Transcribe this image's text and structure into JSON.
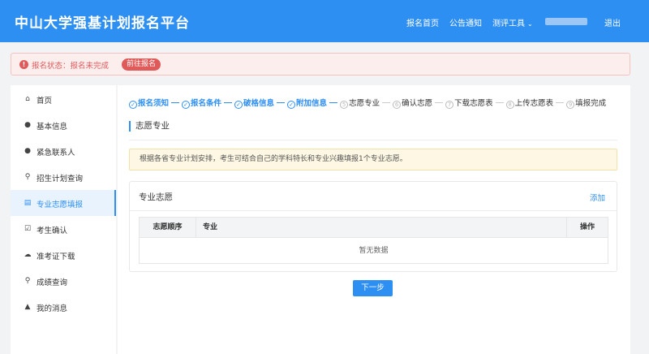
{
  "header": {
    "brand": "中山大学强基计划报名平台",
    "nav": {
      "home": "报名首页",
      "notice": "公告通知",
      "tools": "测评工具",
      "logout": "退出"
    }
  },
  "status": {
    "icon": "!",
    "text": "报名状态：报名未完成",
    "button": "前往报名"
  },
  "sidebar": {
    "items": [
      {
        "label": "首页",
        "icon": "home-icon",
        "glyph": "⌂"
      },
      {
        "label": "基本信息",
        "icon": "user-icon",
        "glyph": "●"
      },
      {
        "label": "紧急联系人",
        "icon": "contact-user-icon",
        "glyph": "●"
      },
      {
        "label": "招生计划查询",
        "icon": "search-icon",
        "glyph": "⚲"
      },
      {
        "label": "专业志愿填报",
        "icon": "form-icon",
        "glyph": "▤"
      },
      {
        "label": "考生确认",
        "icon": "confirm-check-icon",
        "glyph": "☑"
      },
      {
        "label": "准考证下载",
        "icon": "cloud-download-icon",
        "glyph": "☁"
      },
      {
        "label": "成绩查询",
        "icon": "score-search-icon",
        "glyph": "⚲"
      },
      {
        "label": "我的消息",
        "icon": "bell-icon",
        "glyph": "▲"
      }
    ],
    "active_index": 4
  },
  "steps": [
    {
      "num": "✓",
      "label": "报名须知",
      "state": "done"
    },
    {
      "num": "✓",
      "label": "报名条件",
      "state": "done"
    },
    {
      "num": "✓",
      "label": "破格信息",
      "state": "done"
    },
    {
      "num": "✓",
      "label": "附加信息",
      "state": "done"
    },
    {
      "num": "5",
      "label": "志愿专业",
      "state": "todo"
    },
    {
      "num": "6",
      "label": "确认志愿",
      "state": "todo"
    },
    {
      "num": "7",
      "label": "下载志愿表",
      "state": "todo"
    },
    {
      "num": "8",
      "label": "上传志愿表",
      "state": "todo"
    },
    {
      "num": "9",
      "label": "填报完成",
      "state": "todo"
    }
  ],
  "main": {
    "section_title": "志愿专业",
    "notice": "根据各省专业计划安排，考生可结合自己的学科特长和专业兴趣填报1个专业志愿。",
    "card_title": "专业志愿",
    "add_label": "添加",
    "table": {
      "columns": [
        "志愿顺序",
        "专业",
        "操作"
      ],
      "empty_text": "暂无数据"
    },
    "next_label": "下一步"
  },
  "colors": {
    "primary": "#2e8ff3",
    "danger": "#e05a5a",
    "notice_bg": "#fdf7e3"
  }
}
